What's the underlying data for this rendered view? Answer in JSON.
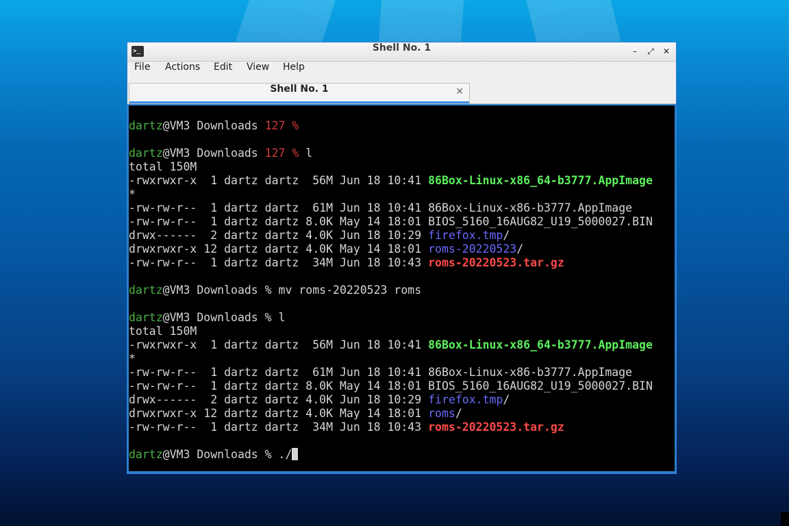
{
  "window": {
    "title": "Shell No. 1",
    "controls": {
      "minimize": "–",
      "restore": "⤢",
      "close": "✕"
    }
  },
  "menu": {
    "items": [
      "File",
      "Actions",
      "Edit",
      "View",
      "Help"
    ]
  },
  "tabs": [
    {
      "label": "Shell No. 1",
      "close": "✕"
    }
  ],
  "prompt": {
    "user": "dartz",
    "host_dir": "@VM3 Downloads ",
    "status_127": "127 %",
    "symbol": "%"
  },
  "terminal": {
    "lines": [
      {
        "segments": []
      },
      {
        "segments": [
          {
            "t": "dartz",
            "c": "c-green"
          },
          {
            "t": "@VM3 Downloads "
          },
          {
            "t": "127 %",
            "c": "c-red"
          }
        ]
      },
      {
        "segments": []
      },
      {
        "segments": [
          {
            "t": "dartz",
            "c": "c-green"
          },
          {
            "t": "@VM3 Downloads "
          },
          {
            "t": "127 %",
            "c": "c-red"
          },
          {
            "t": " l"
          }
        ]
      },
      {
        "segments": [
          {
            "t": "total 150M"
          }
        ]
      },
      {
        "segments": [
          {
            "t": "-rwxrwxr-x  1 dartz dartz  56M Jun 18 10:41 "
          },
          {
            "t": "86Box-Linux-x86_64-b3777.AppImage",
            "c": "c-exec"
          }
        ]
      },
      {
        "segments": [
          {
            "t": "*"
          }
        ]
      },
      {
        "segments": [
          {
            "t": "-rw-rw-r--  1 dartz dartz  61M Jun 18 10:41 86Box-Linux-x86-b3777.AppImage"
          }
        ]
      },
      {
        "segments": [
          {
            "t": "-rw-rw-r--  1 dartz dartz 8.0K May 14 18:01 BIOS_5160_16AUG82_U19_5000027.BIN"
          }
        ]
      },
      {
        "segments": [
          {
            "t": "drwx------  2 dartz dartz 4.0K Jun 18 10:29 "
          },
          {
            "t": "firefox.tmp",
            "c": "c-dir"
          },
          {
            "t": "/"
          }
        ]
      },
      {
        "segments": [
          {
            "t": "drwxrwxr-x 12 dartz dartz 4.0K May 14 18:01 "
          },
          {
            "t": "roms-20220523",
            "c": "c-dir"
          },
          {
            "t": "/"
          }
        ]
      },
      {
        "segments": [
          {
            "t": "-rw-rw-r--  1 dartz dartz  34M Jun 18 10:43 "
          },
          {
            "t": "roms-20220523.tar.gz",
            "c": "c-arch"
          }
        ]
      },
      {
        "segments": []
      },
      {
        "segments": [
          {
            "t": "dartz",
            "c": "c-green"
          },
          {
            "t": "@VM3 Downloads % mv roms-20220523 roms"
          }
        ]
      },
      {
        "segments": []
      },
      {
        "segments": [
          {
            "t": "dartz",
            "c": "c-green"
          },
          {
            "t": "@VM3 Downloads % l"
          }
        ]
      },
      {
        "segments": [
          {
            "t": "total 150M"
          }
        ]
      },
      {
        "segments": [
          {
            "t": "-rwxrwxr-x  1 dartz dartz  56M Jun 18 10:41 "
          },
          {
            "t": "86Box-Linux-x86_64-b3777.AppImage",
            "c": "c-exec"
          }
        ]
      },
      {
        "segments": [
          {
            "t": "*"
          }
        ]
      },
      {
        "segments": [
          {
            "t": "-rw-rw-r--  1 dartz dartz  61M Jun 18 10:41 86Box-Linux-x86-b3777.AppImage"
          }
        ]
      },
      {
        "segments": [
          {
            "t": "-rw-rw-r--  1 dartz dartz 8.0K May 14 18:01 BIOS_5160_16AUG82_U19_5000027.BIN"
          }
        ]
      },
      {
        "segments": [
          {
            "t": "drwx------  2 dartz dartz 4.0K Jun 18 10:29 "
          },
          {
            "t": "firefox.tmp",
            "c": "c-dir"
          },
          {
            "t": "/"
          }
        ]
      },
      {
        "segments": [
          {
            "t": "drwxrwxr-x 12 dartz dartz 4.0K May 14 18:01 "
          },
          {
            "t": "roms",
            "c": "c-dir"
          },
          {
            "t": "/"
          }
        ]
      },
      {
        "segments": [
          {
            "t": "-rw-rw-r--  1 dartz dartz  34M Jun 18 10:43 "
          },
          {
            "t": "roms-20220523.tar.gz",
            "c": "c-arch"
          }
        ]
      },
      {
        "segments": []
      },
      {
        "segments": [
          {
            "t": "dartz",
            "c": "c-green"
          },
          {
            "t": "@VM3 Downloads % ./"
          }
        ],
        "cursor": true
      }
    ]
  },
  "colors": {
    "prompt_user": "#4bb14b",
    "exit_status": "#d23a3a",
    "executable": "#5ef05e",
    "directory": "#6a6aff",
    "archive": "#ff4a4a",
    "tab_accent": "#3d8ee8",
    "window_border": "#2d7fd0"
  }
}
